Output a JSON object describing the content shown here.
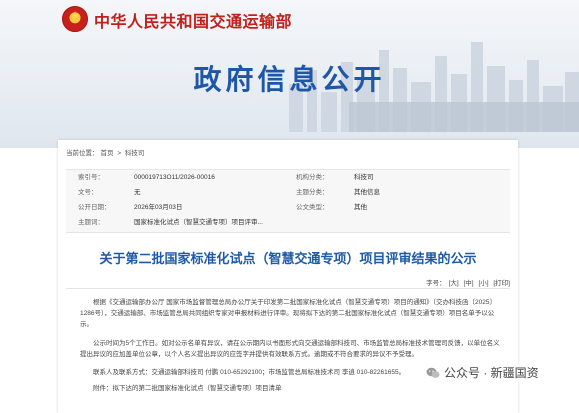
{
  "header": {
    "ministry_name": "中华人民共和国交通运输部",
    "banner_title": "政府信息公开"
  },
  "breadcrumb": {
    "label": "当前位置：",
    "items": [
      "首页",
      "科技司"
    ],
    "separator": ">"
  },
  "meta": {
    "index_label": "索引号：",
    "index_value": "000019713O11/2026-00016",
    "org_label": "机构分类：",
    "org_value": "科技司",
    "doc_label": "文号：",
    "doc_value": "无",
    "topic_label": "主题分类：",
    "topic_value": "其他信息",
    "date_label": "公开日期：",
    "date_value": "2026年03月03日",
    "type_label": "公文类型：",
    "type_value": "其他",
    "subject_label": "主题词：",
    "subject_value": "国家标准化试点（智慧交通专项）项目评审..."
  },
  "document": {
    "title": "关于第二批国家标准化试点（智慧交通专项）项目评审结果的公示",
    "font_size_label": "字号：",
    "font_size_options": [
      "[大]",
      "[中]",
      "[小]",
      "[打印]"
    ],
    "para1": "根据《交通运输部办公厅 国家市场监督管理总局办公厅关于印发第二批国家标准化试点（智慧交通专项）项目的通知》（交办科技函〔2025〕1286号），交通运输部、市场监管总局共同组织专家对申报材料进行评审。现将拟下达的第二批国家标准化试点（智慧交通专项）项目名单予以公示。",
    "para2": "公示时间为5个工作日。如对公示名单有异议，请在公示期内以书面形式向交通运输部科技司、市场监管总局标准技术管理司反馈，以单位名义提出异议的应加盖单位公章，以个人名义提出异议的应签字并提供有效联系方式。逾期或不符合要求的异议不予受理。",
    "para3": "联系人及联系方式：交通运输部科技司 付鹏 010-65292100；市场监管总局标准技术司 李逍 010-82261655。",
    "para4": "附件：拟下达的第二批国家标准化试点（智慧交通专项）项目清单"
  },
  "watermark": {
    "text": "公众号 · 新疆国资"
  },
  "colors": {
    "ministry_red": "#c0211b",
    "title_blue": "#1e5aa8",
    "banner_blue": "#1f57a8"
  }
}
